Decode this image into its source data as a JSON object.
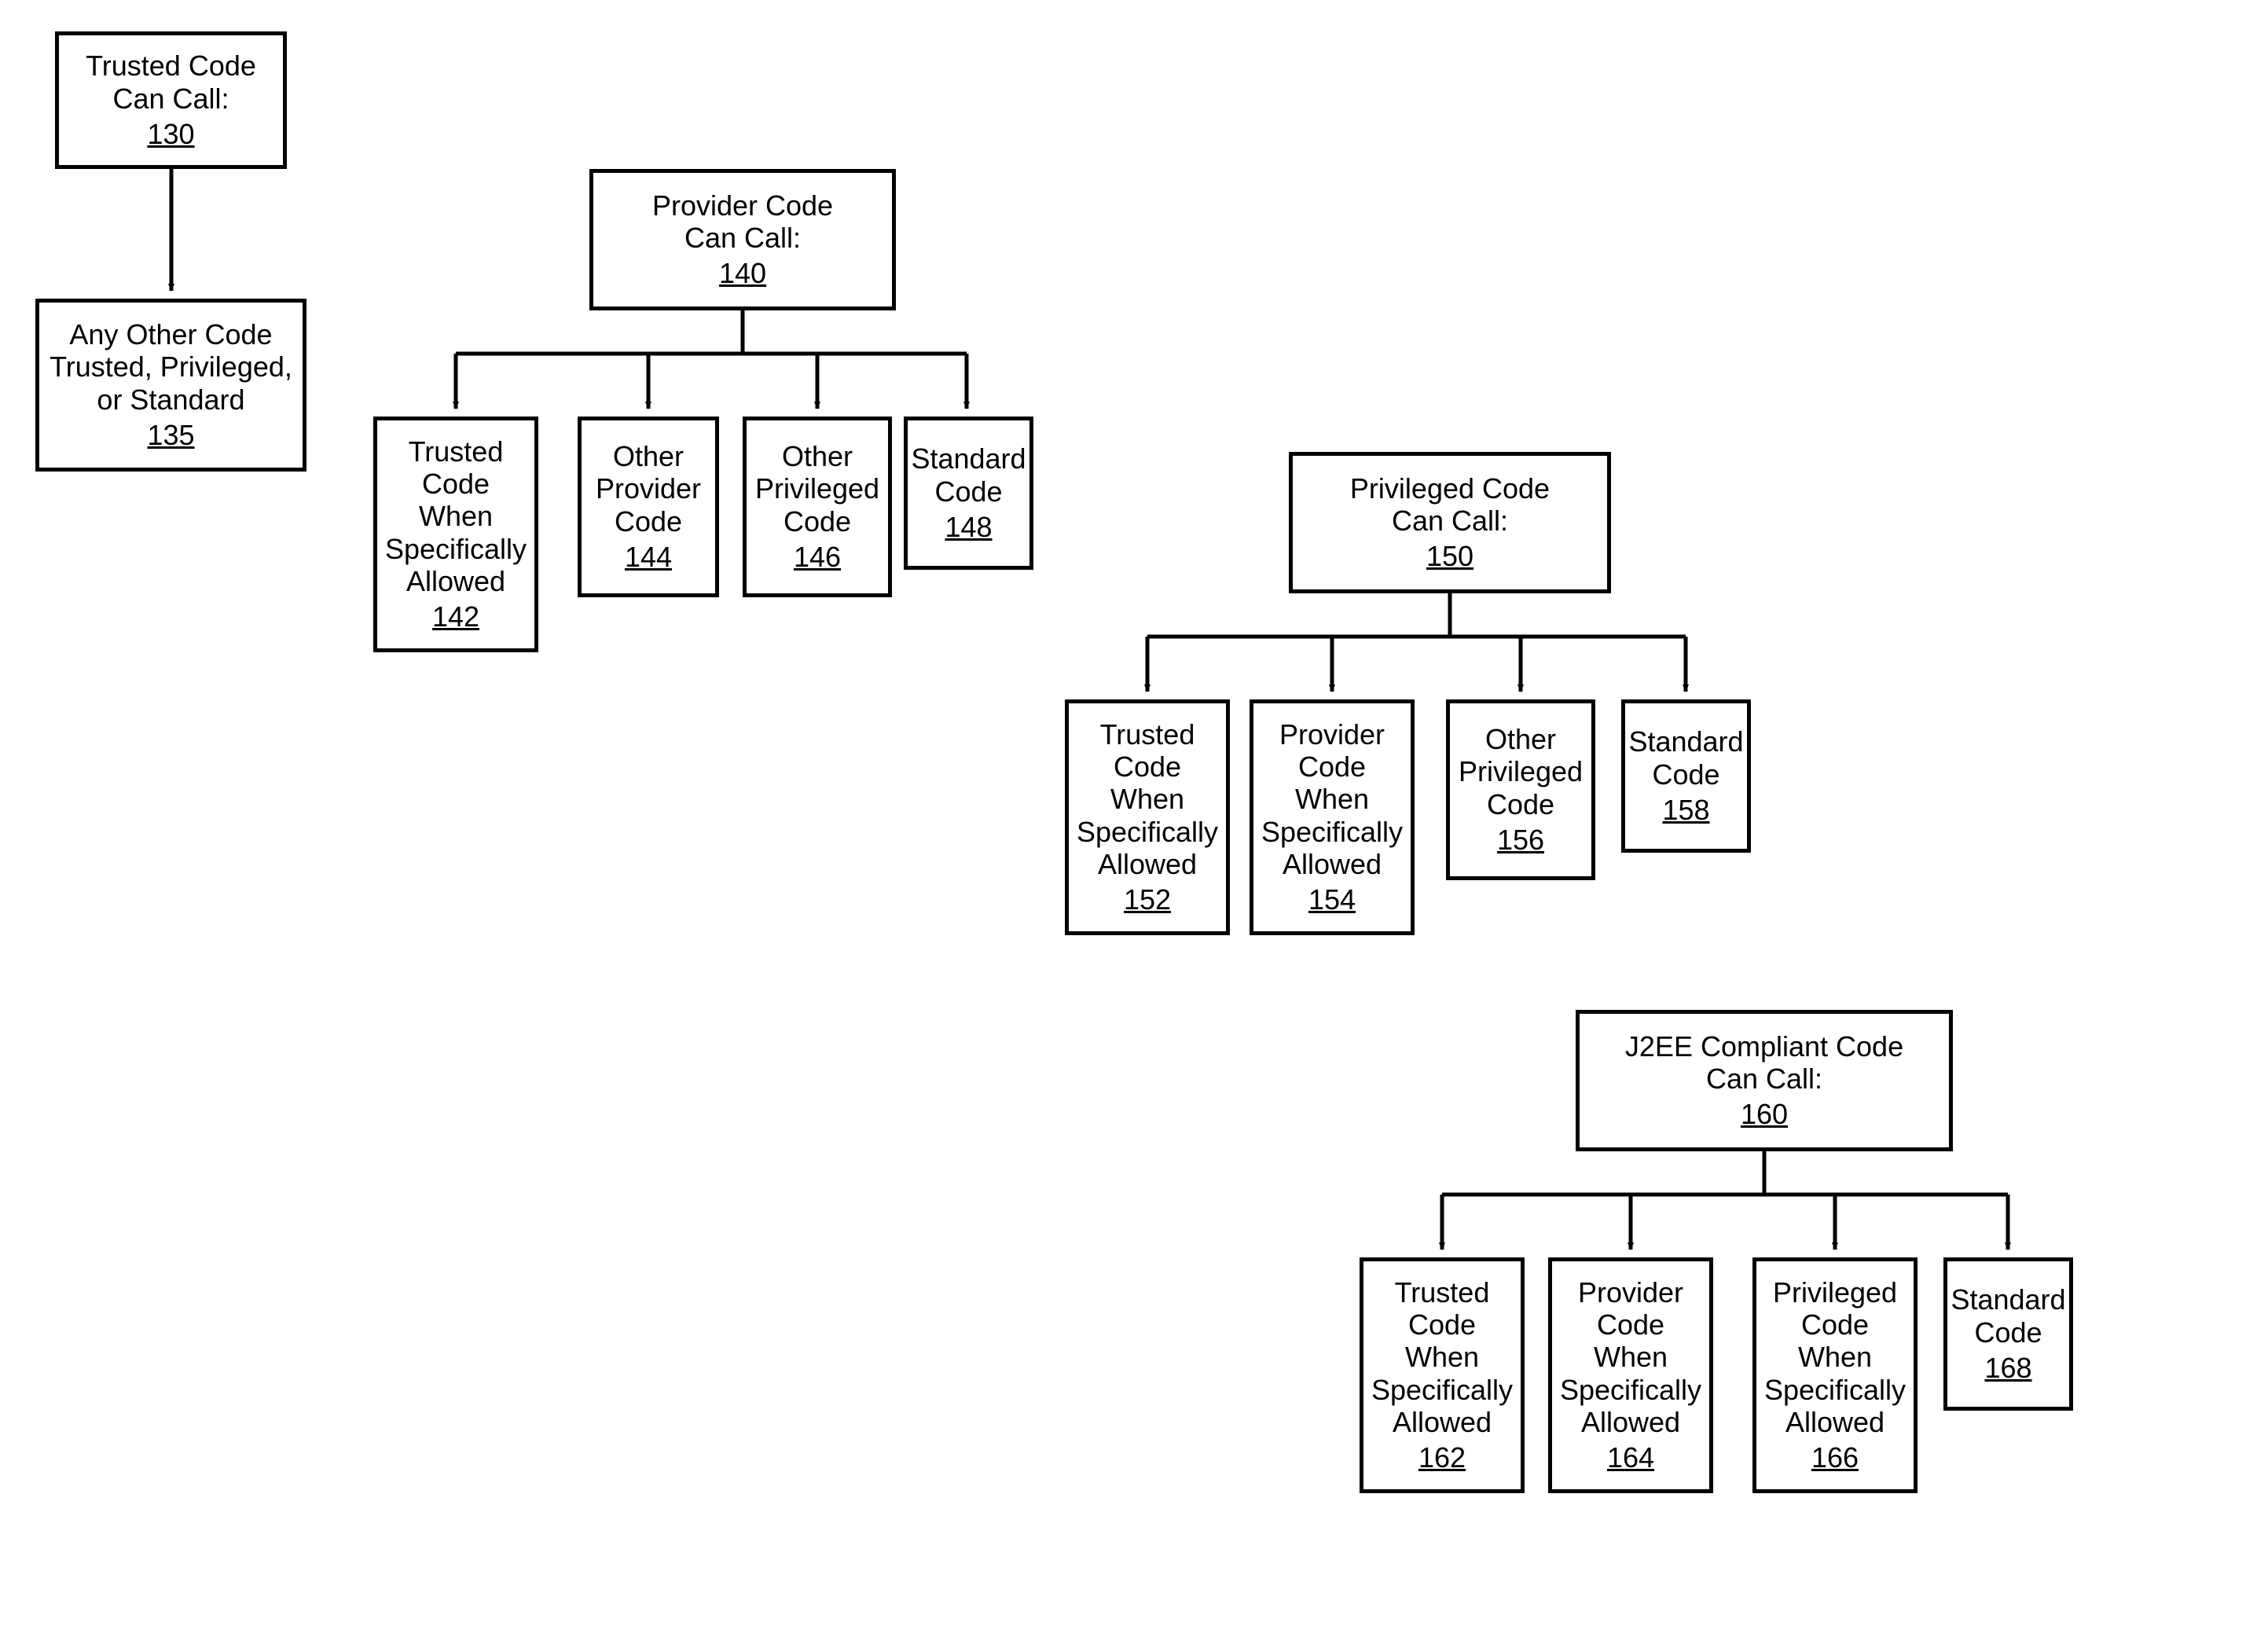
{
  "diagram": {
    "trusted": {
      "label": "Trusted Code\nCan Call:",
      "ref": "130"
    },
    "trustedChild": {
      "label": "Any Other Code\nTrusted, Privileged,\nor Standard",
      "ref": "135"
    },
    "provider": {
      "label": "Provider Code\nCan Call:",
      "ref": "140"
    },
    "providerChildren": {
      "c1": {
        "label": "Trusted\nCode When\nSpecifically\nAllowed",
        "ref": "142"
      },
      "c2": {
        "label": "Other\nProvider\nCode",
        "ref": "144"
      },
      "c3": {
        "label": "Other\nPrivileged\nCode",
        "ref": "146"
      },
      "c4": {
        "label": "Standard\nCode",
        "ref": "148"
      }
    },
    "privileged": {
      "label": "Privileged Code\nCan Call:",
      "ref": "150"
    },
    "privilegedChildren": {
      "c1": {
        "label": "Trusted\nCode When\nSpecifically\nAllowed",
        "ref": "152"
      },
      "c2": {
        "label": "Provider\nCode When\nSpecifically\nAllowed",
        "ref": "154"
      },
      "c3": {
        "label": "Other\nPrivileged\nCode",
        "ref": "156"
      },
      "c4": {
        "label": "Standard\nCode",
        "ref": "158"
      }
    },
    "j2ee": {
      "label": "J2EE Compliant Code\nCan Call:",
      "ref": "160"
    },
    "j2eeChildren": {
      "c1": {
        "label": "Trusted\nCode When\nSpecifically\nAllowed",
        "ref": "162"
      },
      "c2": {
        "label": "Provider\nCode When\nSpecifically\nAllowed",
        "ref": "164"
      },
      "c3": {
        "label": "Privileged\nCode When\nSpecifically\nAllowed",
        "ref": "166"
      },
      "c4": {
        "label": "Standard\nCode",
        "ref": "168"
      }
    }
  }
}
